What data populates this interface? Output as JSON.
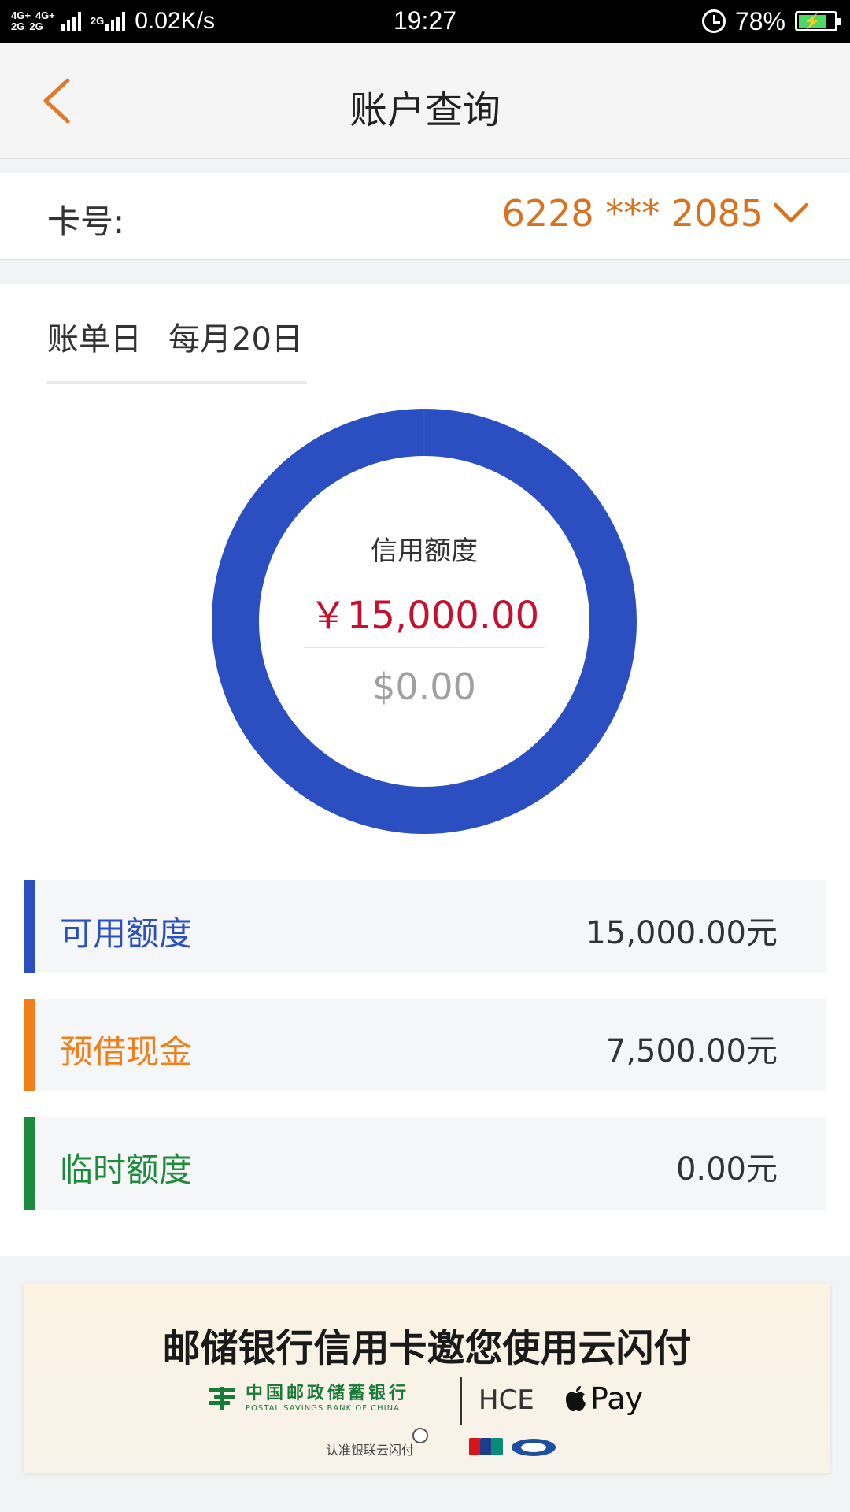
{
  "status_bar": {
    "network_top": [
      "4G+",
      "4G+"
    ],
    "network_bottom": [
      "2G",
      "2G"
    ],
    "network_right": "2G",
    "speed": "0.02K/s",
    "time": "19:27",
    "battery": "78%",
    "battery_level": 0.78,
    "icons": [
      "signal-icon",
      "alarm-icon",
      "battery-charging-icon"
    ]
  },
  "nav": {
    "title": "账户查询",
    "back_icon": "chevron-left-icon"
  },
  "card": {
    "label": "卡号:",
    "number": "6228 *** 2085",
    "dropdown_icon": "chevron-down-icon"
  },
  "bill": {
    "label": "账单日",
    "value": "每月20日"
  },
  "donut": {
    "label": "信用额度",
    "amount_cny": "￥15,000.00",
    "amount_usd": "$0.00",
    "ring_color": "#2b4fc1",
    "available_fraction": 1.0
  },
  "limits": [
    {
      "name": "可用额度",
      "value": "15,000.00元",
      "color": "#2b4fc1"
    },
    {
      "name": "预借现金",
      "value": "7,500.00元",
      "color": "#f07f1a"
    },
    {
      "name": "临时额度",
      "value": "0.00元",
      "color": "#1e8a3c"
    }
  ],
  "banner": {
    "headline_a": "邮储银行信用卡邀您使用",
    "headline_b": "云闪付",
    "bank_cn": "中国邮政储蓄银行",
    "bank_en": "POSTAL SAVINGS BANK OF CHINA",
    "hce": "HCE",
    "pay": "Pay",
    "recognize": "认准银联云闪付"
  },
  "colors": {
    "accent": "#d9721f",
    "amount_red": "#c8102e"
  }
}
